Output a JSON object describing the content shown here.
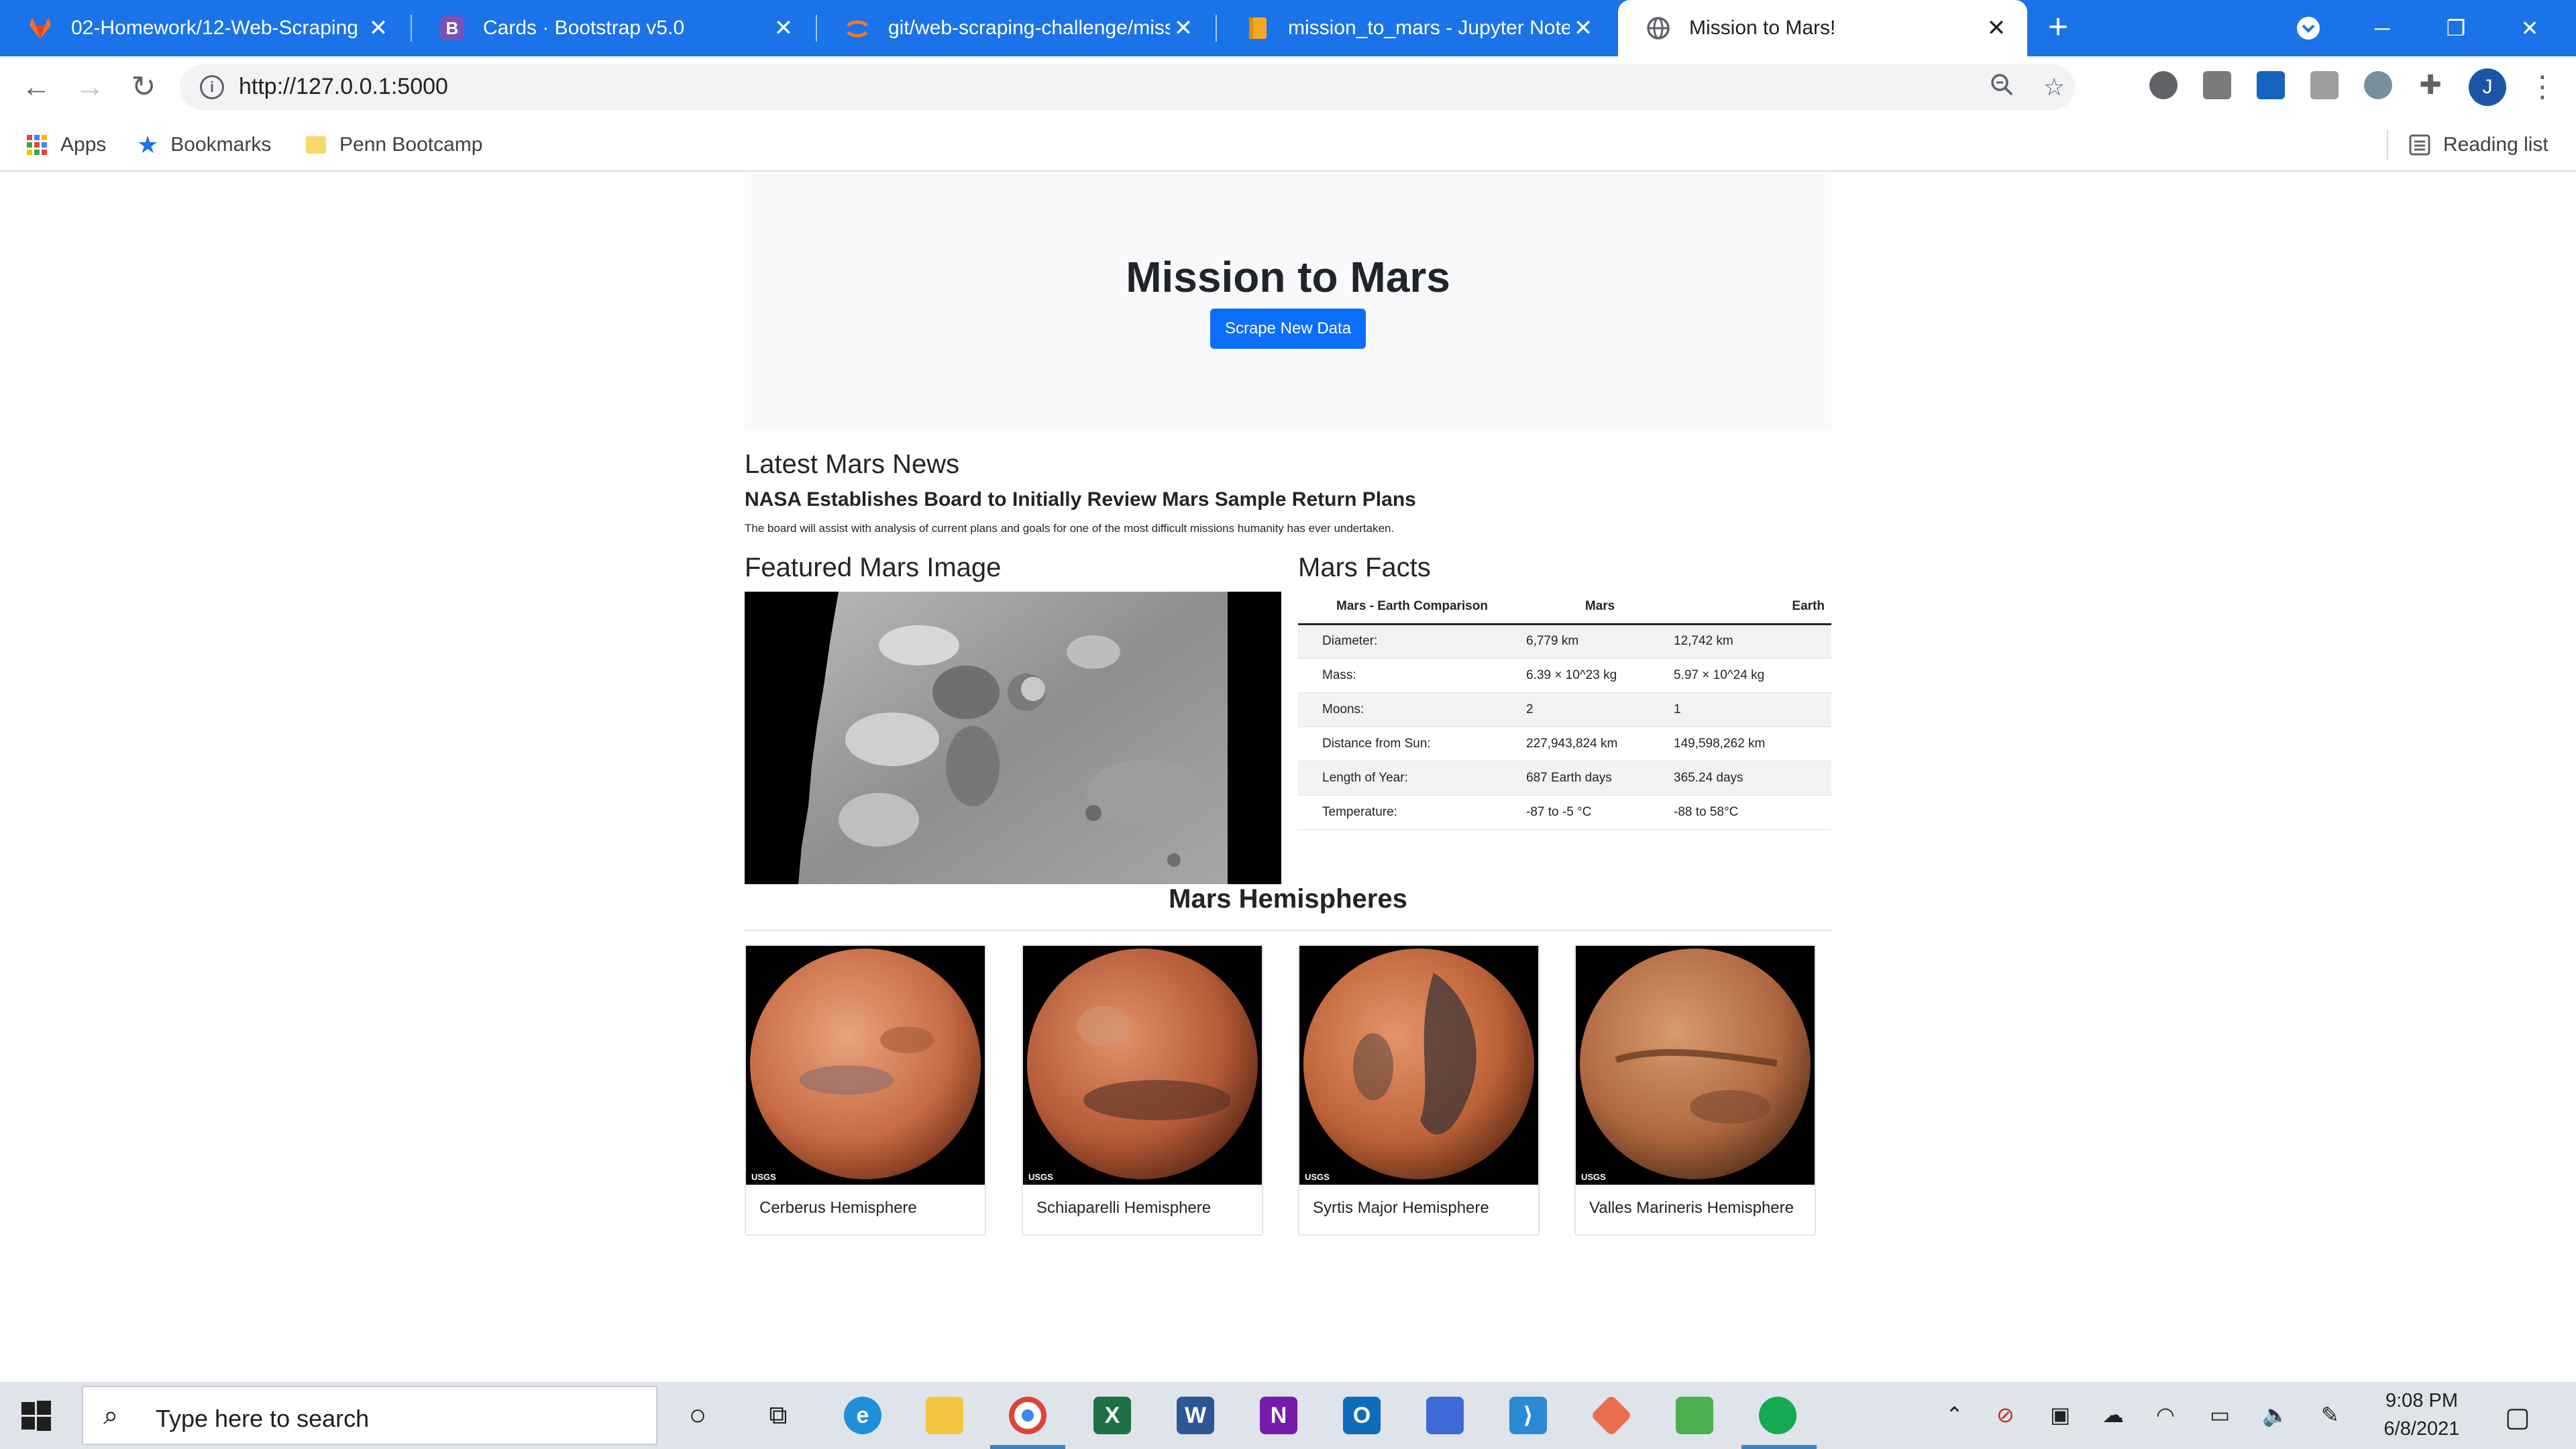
{
  "browser": {
    "tabs": [
      {
        "title": "02-Homework/12-Web-Scraping",
        "icon": "gitlab-icon"
      },
      {
        "title": "Cards · Bootstrap v5.0",
        "icon": "bootstrap-icon"
      },
      {
        "title": "git/web-scraping-challenge/miss",
        "icon": "jupyter-icon"
      },
      {
        "title": "mission_to_mars - Jupyter Noteb",
        "icon": "notebook-icon"
      },
      {
        "title": "Mission to Mars!",
        "icon": "globe-icon"
      }
    ],
    "url": "http://127.0.0.1:5000",
    "profile_initial": "J",
    "bookmarks": {
      "apps": "Apps",
      "bookmarks": "Bookmarks",
      "penn": "Penn Bootcamp",
      "reading_list": "Reading list"
    },
    "colors": {
      "accent": "#1A73E8"
    }
  },
  "page": {
    "title": "Mission to Mars",
    "scrape_button": "Scrape New Data",
    "news": {
      "heading": "Latest Mars News",
      "title": "NASA Establishes Board to Initially Review Mars Sample Return Plans",
      "teaser": "The board will assist with analysis of current plans and goals for one of the most difficult missions humanity has ever undertaken."
    },
    "featured": {
      "heading": "Featured Mars Image"
    },
    "facts": {
      "heading": "Mars Facts",
      "columns": [
        "Mars - Earth Comparison",
        "Mars",
        "Earth"
      ],
      "rows": [
        [
          "Diameter:",
          "6,779 km",
          "12,742 km"
        ],
        [
          "Mass:",
          "6.39 × 10^23 kg",
          "5.97 × 10^24 kg"
        ],
        [
          "Moons:",
          "2",
          "1"
        ],
        [
          "Distance from Sun:",
          "227,943,824 km",
          "149,598,262 km"
        ],
        [
          "Length of Year:",
          "687 Earth days",
          "365.24 days"
        ],
        [
          "Temperature:",
          "-87 to -5 °C",
          "-88 to 58°C"
        ]
      ]
    },
    "hemispheres": {
      "heading": "Mars Hemispheres",
      "watermark": "USGS",
      "items": [
        {
          "title": "Cerberus Hemisphere"
        },
        {
          "title": "Schiaparelli Hemisphere"
        },
        {
          "title": "Syrtis Major Hemisphere"
        },
        {
          "title": "Valles Marineris Hemisphere"
        }
      ]
    }
  },
  "taskbar": {
    "search_placeholder": "Type here to search",
    "time": "9:08 PM",
    "date": "6/8/2021"
  }
}
